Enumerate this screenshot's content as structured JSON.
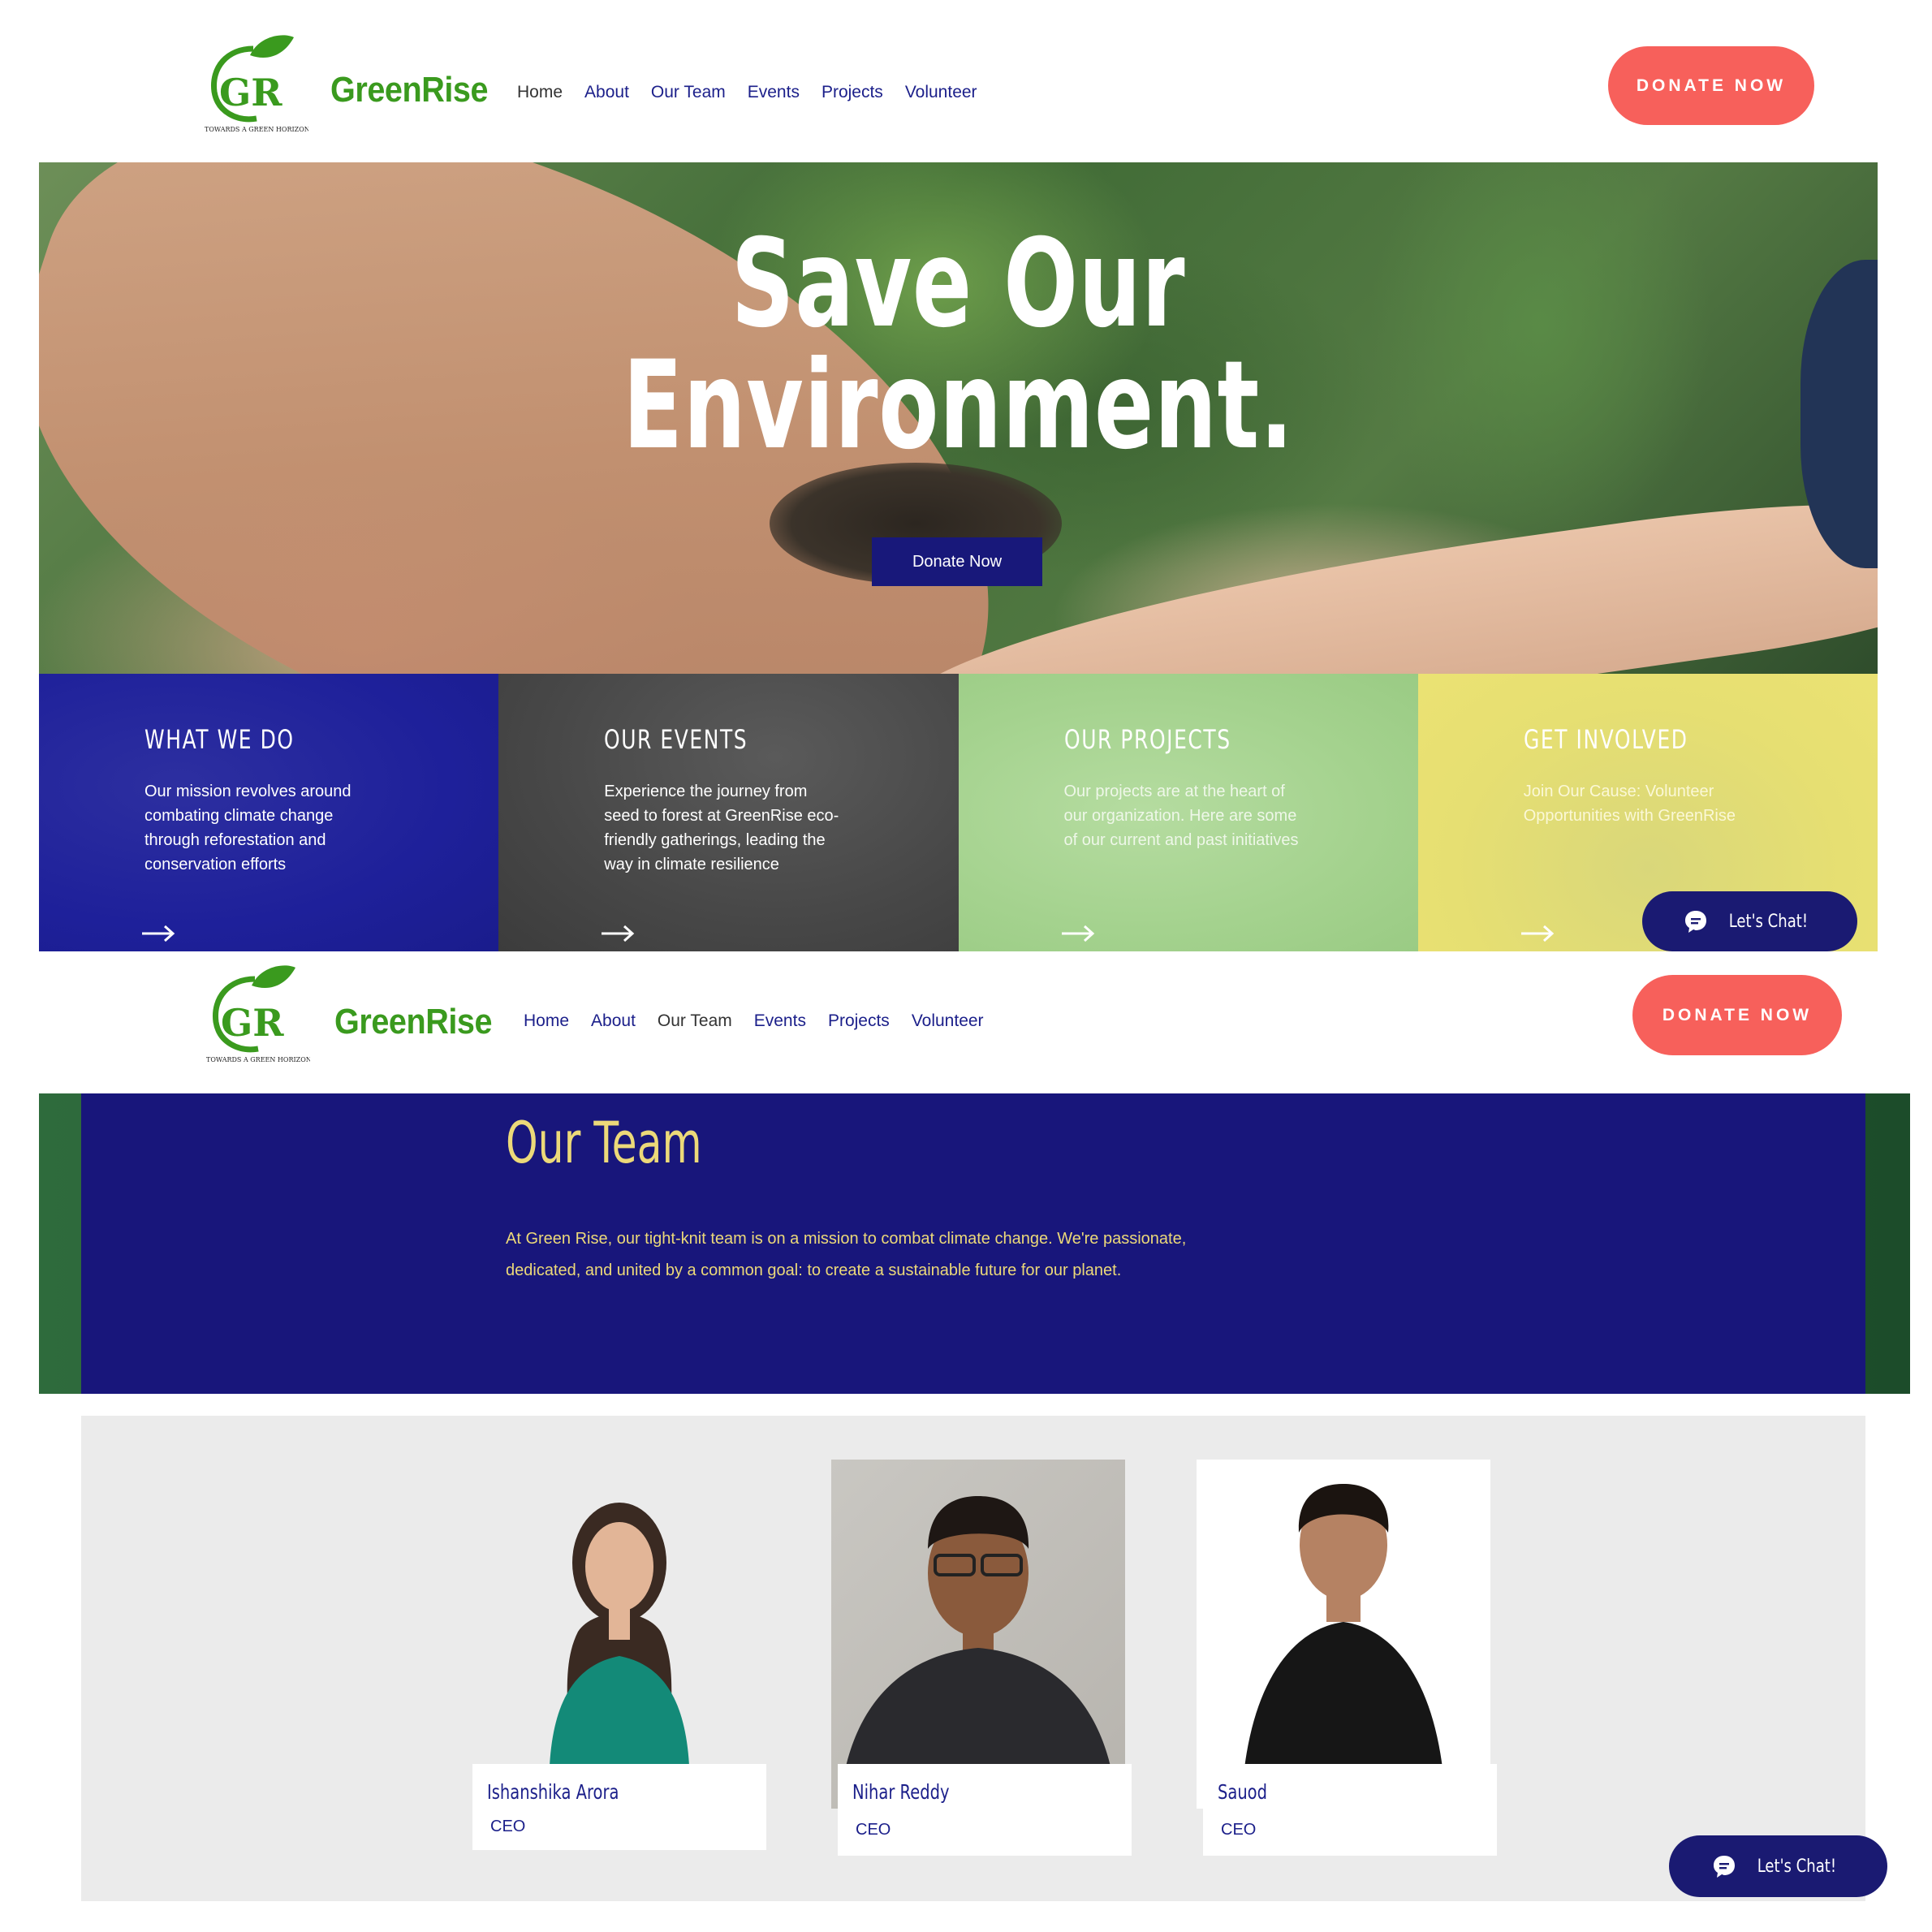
{
  "brand": {
    "name": "GreenRise",
    "tagline": "Towards a Green Horizon",
    "colors": {
      "green": "#3a9a1e",
      "navy": "#1b1f8a",
      "coral": "#f7605b",
      "gold": "#ecd979"
    }
  },
  "header_top": {
    "nav": [
      "Home",
      "About",
      "Our Team",
      "Events",
      "Projects",
      "Volunteer"
    ],
    "active": "Home",
    "donate_label": "DONATE NOW"
  },
  "hero": {
    "title_line1": "Save Our",
    "title_line2": "Environment.",
    "button_label": "Donate Now"
  },
  "tiles": [
    {
      "title": "WHAT WE DO",
      "text": "Our mission revolves around combating climate change through reforestation and conservation efforts",
      "icon": "arrow-right-icon"
    },
    {
      "title": "OUR EVENTS",
      "text": "Experience the journey from seed to forest at GreenRise eco-friendly gatherings, leading the way in climate resilience",
      "icon": "arrow-right-icon"
    },
    {
      "title": "OUR PROJECTS",
      "text": "Our projects are at the heart of our organization. Here are some of our current and past initiatives",
      "icon": "arrow-right-icon"
    },
    {
      "title": "GET INVOLVED",
      "text": "Join Our Cause: Volunteer Opportunities with GreenRise",
      "icon": "arrow-right-icon"
    }
  ],
  "chat": {
    "label": "Let's Chat!",
    "icon": "chat-bubble-icon"
  },
  "header_bottom": {
    "nav": [
      "Home",
      "About",
      "Our Team",
      "Events",
      "Projects",
      "Volunteer"
    ],
    "active": "Our Team",
    "donate_label": "DONATE NOW"
  },
  "team": {
    "title": "Our Team",
    "description": "At Green Rise, our tight-knit team is on a mission to combat climate change. We're passionate, dedicated, and united by a common goal: to create a sustainable future for our planet.",
    "members": [
      {
        "name": "Ishanshika Arora",
        "role": "CEO"
      },
      {
        "name": "Nihar Reddy",
        "role": "CEO"
      },
      {
        "name": "Sauod",
        "role": "CEO"
      }
    ]
  }
}
